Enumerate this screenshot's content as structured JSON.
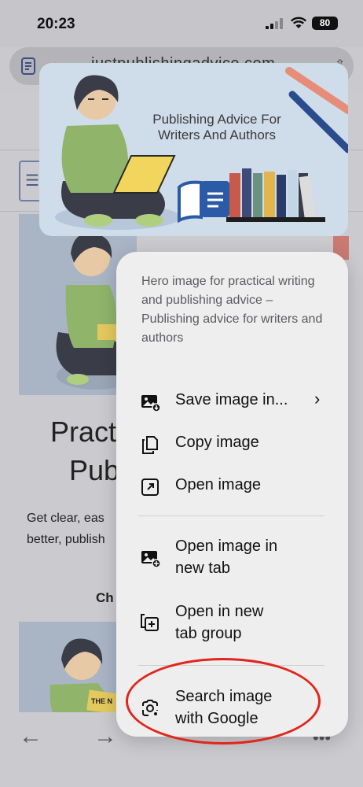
{
  "status_bar": {
    "time": "20:23",
    "battery": "80"
  },
  "address_bar": {
    "url": "justpublishingadvice.com"
  },
  "page": {
    "title_line1": "Pract",
    "title_line2": "Pub",
    "text_line1": "Get clear, eas",
    "text_line2": "better, publish",
    "subheading": "Ch"
  },
  "preview": {
    "caption": "Publishing Advice For Writers And Authors"
  },
  "context_menu": {
    "description": "Hero image for practical writing and publishing advice – Publishing advice for writers and authors",
    "items": [
      {
        "label": "Save image in...",
        "icon": "save-image-icon"
      },
      {
        "label": "Copy image",
        "icon": "copy-icon"
      },
      {
        "label": "Open image",
        "icon": "open-external-icon"
      },
      {
        "label_line1": "Open image in",
        "label_line2": "new tab",
        "icon": "image-new-tab-icon"
      },
      {
        "label_line1": "Open in new",
        "label_line2": "tab group",
        "icon": "tab-group-icon"
      },
      {
        "label_line1": "Search image",
        "label_line2": "with Google",
        "icon": "google-lens-icon"
      }
    ]
  },
  "colors": {
    "menu_background": "#eeeeef",
    "highlight_ring": "#e0261d",
    "preview_background": "#cfdcea"
  }
}
